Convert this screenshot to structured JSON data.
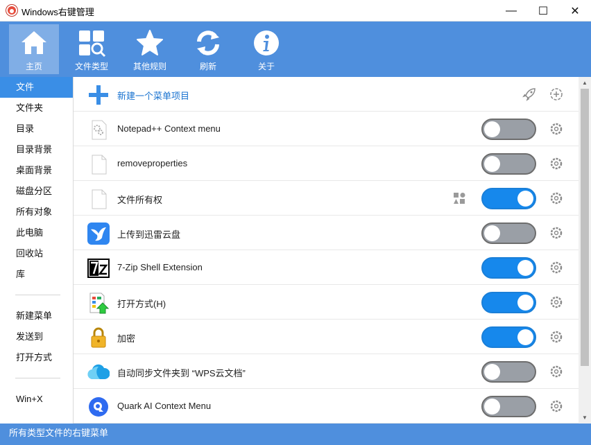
{
  "window": {
    "title": "Windows右键管理",
    "minimize": "—",
    "maximize": "☐",
    "close": "✕"
  },
  "toolbar": {
    "items": [
      {
        "label": "主页",
        "icon": "home-icon",
        "active": true
      },
      {
        "label": "文件类型",
        "icon": "file-types-icon"
      },
      {
        "label": "其他规则",
        "icon": "star-icon"
      },
      {
        "label": "刷新",
        "icon": "refresh-icon"
      },
      {
        "label": "关于",
        "icon": "info-icon"
      }
    ]
  },
  "sidebar": {
    "items": [
      {
        "label": "文件",
        "selected": true
      },
      {
        "label": "文件夹"
      },
      {
        "label": "目录"
      },
      {
        "label": "目录背景"
      },
      {
        "label": "桌面背景"
      },
      {
        "label": "磁盘分区"
      },
      {
        "label": "所有对象"
      },
      {
        "label": "此电脑"
      },
      {
        "label": "回收站"
      },
      {
        "label": "库"
      }
    ],
    "group2": [
      {
        "label": "新建菜单"
      },
      {
        "label": "发送到"
      },
      {
        "label": "打开方式"
      }
    ],
    "group3": [
      {
        "label": "Win+X"
      }
    ]
  },
  "content": {
    "new_item_label": "新建一个菜单项目",
    "rows": [
      {
        "label": "Notepad++ Context menu",
        "icon": "notepad-gear-icon",
        "enabled": false
      },
      {
        "label": "removeproperties",
        "icon": "blank-file-icon",
        "enabled": false
      },
      {
        "label": "文件所有权",
        "icon": "blank-file-icon",
        "enabled": true,
        "extra_icon": "shapes-icon"
      },
      {
        "label": "上传到迅雷云盘",
        "icon": "thunder-bird-icon",
        "enabled": false
      },
      {
        "label": "7-Zip Shell Extension",
        "icon": "7zip-icon",
        "enabled": true
      },
      {
        "label": "打开方式(H)",
        "icon": "open-with-icon",
        "enabled": true
      },
      {
        "label": "加密",
        "icon": "lock-icon",
        "enabled": true
      },
      {
        "label": "自动同步文件夹到 “WPS云文档”",
        "icon": "cloud-icon",
        "enabled": false
      },
      {
        "label": "Quark AI Context Menu",
        "icon": "quark-icon",
        "enabled": false
      }
    ]
  },
  "status": {
    "text": "所有类型文件的右键菜单"
  },
  "colors": {
    "accent": "#4f8fdd",
    "toggle_on": "#1688ec",
    "toggle_off": "#9a9fa6",
    "selected": "#3a8ee6"
  }
}
